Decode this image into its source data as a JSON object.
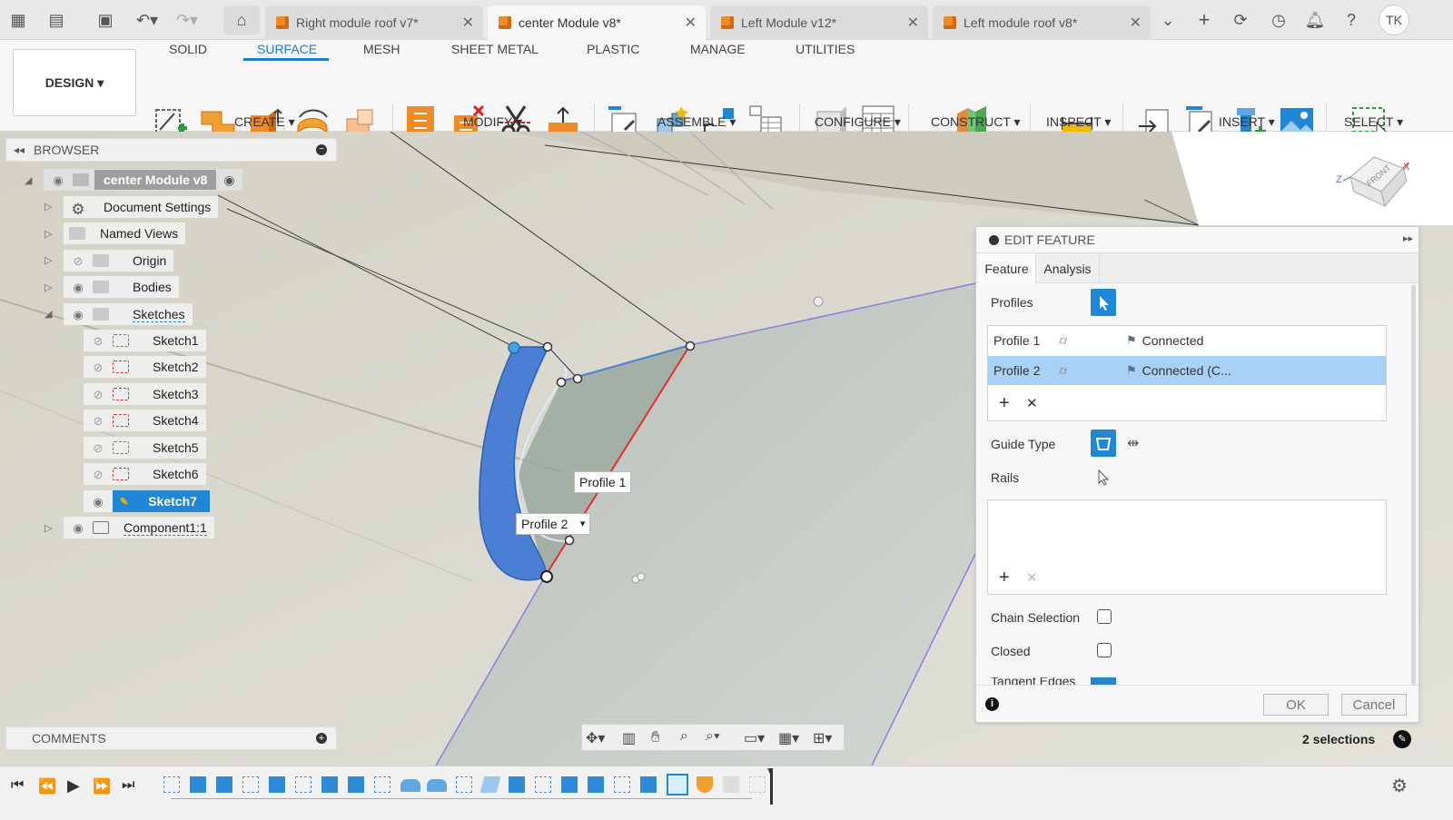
{
  "doc_tabs": [
    {
      "label": "Right module roof v7*",
      "active": false
    },
    {
      "label": "center Module v8*",
      "active": true
    },
    {
      "label": "Left Module v12*",
      "active": false
    },
    {
      "label": "Left module roof v8*",
      "active": false
    }
  ],
  "user_initials": "TK",
  "ribbon": {
    "tabs": [
      "SOLID",
      "SURFACE",
      "MESH",
      "SHEET METAL",
      "PLASTIC",
      "MANAGE",
      "UTILITIES"
    ],
    "active_tab": "SURFACE",
    "workspace": "DESIGN",
    "groups": [
      "CREATE",
      "MODIFY",
      "ASSEMBLE",
      "CONFIGURE",
      "CONSTRUCT",
      "INSPECT",
      "INSERT",
      "SELECT"
    ]
  },
  "browser": {
    "title": "BROWSER",
    "root": "center Module v8",
    "items": [
      {
        "label": "Document Settings"
      },
      {
        "label": "Named Views"
      },
      {
        "label": "Origin"
      },
      {
        "label": "Bodies"
      },
      {
        "label": "Sketches"
      }
    ],
    "sketches": [
      "Sketch1",
      "Sketch2",
      "Sketch3",
      "Sketch4",
      "Sketch5",
      "Sketch6",
      "Sketch7"
    ],
    "component": "Component1:1"
  },
  "viewport": {
    "profile1_tag": "Profile 1",
    "profile2_tag": "Profile 2",
    "viewcube_label": "FRONT",
    "axis_z": "Z",
    "axis_x": "X"
  },
  "edit_feature": {
    "title": "EDIT FEATURE",
    "tabs": [
      "Feature",
      "Analysis"
    ],
    "active_tab": "Feature",
    "profiles_label": "Profiles",
    "profiles": [
      {
        "name": "Profile 1",
        "continuity": "Connected",
        "selected": false
      },
      {
        "name": "Profile 2",
        "continuity": "Connected (C...",
        "selected": true
      }
    ],
    "guide_type_label": "Guide Type",
    "rails_label": "Rails",
    "chain_selection_label": "Chain Selection",
    "chain_selection": false,
    "closed_label": "Closed",
    "closed": false,
    "tangent_edges_label": "Tangent Edges",
    "ok_label": "OK",
    "cancel_label": "Cancel"
  },
  "comments_label": "COMMENTS",
  "selection_count": "2 selections",
  "colors": {
    "accent": "#1f87d6",
    "selected_row": "#a9d0f5",
    "profile_fill": "#4a7fd4",
    "edge_red": "#e03030"
  }
}
